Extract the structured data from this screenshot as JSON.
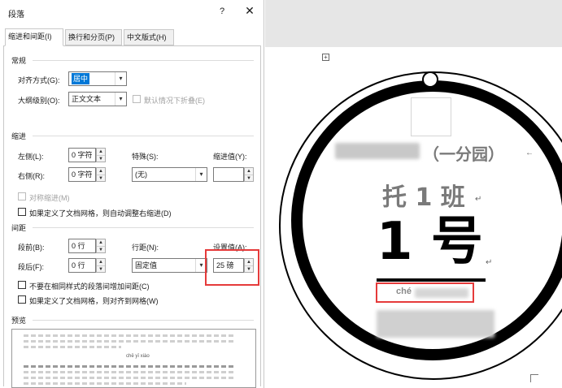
{
  "dialog": {
    "title": "段落",
    "help": "?",
    "close": "✕",
    "tabs": [
      "缩进和间距(I)",
      "换行和分页(P)",
      "中文版式(H)"
    ],
    "general": {
      "section": "常规",
      "align_label": "对齐方式(G):",
      "align_value": "居中",
      "outline_label": "大纲级别(O):",
      "outline_value": "正文文本",
      "collapse_label": "默认情况下折叠(E)"
    },
    "indent": {
      "section": "缩进",
      "left_label": "左侧(L):",
      "left_value": "0 字符",
      "right_label": "右侧(R):",
      "right_value": "0 字符",
      "special_label": "特殊(S):",
      "special_value": "(无)",
      "amount_label": "缩进值(Y):",
      "amount_value": "",
      "mirror_label": "对称缩进(M)",
      "grid_label": "如果定义了文档网格，则自动调整右缩进(D)"
    },
    "spacing": {
      "section": "间距",
      "before_label": "段前(B):",
      "before_value": "0 行",
      "after_label": "段后(F):",
      "after_value": "0 行",
      "line_label": "行距(N):",
      "line_value": "固定值",
      "at_label": "设置值(A):",
      "at_value": "25 磅",
      "no_space_label": "不要在相同样式的段落间增加间距(C)",
      "snap_label": "如果定义了文档网格，则对齐到网格(W)"
    },
    "preview": {
      "section": "预览",
      "sample_pinyin": "chē yī xiào"
    }
  },
  "document": {
    "school_suffix": "（一分园）",
    "class_name": "托 1 班",
    "number": "1 号",
    "pinyin_prefix": "ché",
    "highlight_color": "#e53a3a"
  },
  "icons": {
    "arrow": "▾",
    "spin_up": "▲",
    "spin_down": "▼",
    "paragraph_mark": "↵",
    "anchor": "+"
  }
}
